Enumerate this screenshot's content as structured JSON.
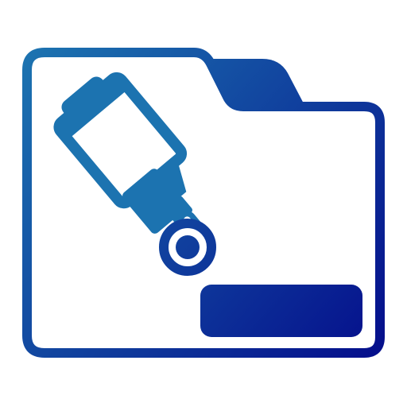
{
  "icon": {
    "name": "microscope-folder-icon",
    "gradient": {
      "start": "#1C73B0",
      "end": "#050F8C"
    },
    "background": "#FFFFFF"
  }
}
